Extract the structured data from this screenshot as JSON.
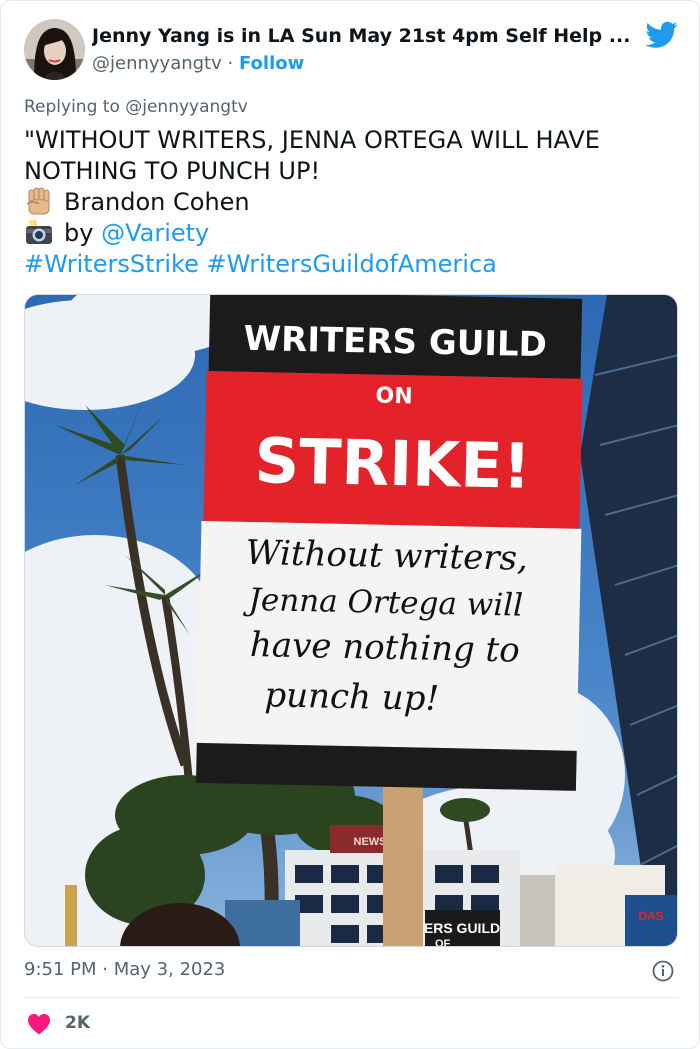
{
  "author": {
    "display_name": "Jenny Yang is in LA Sun May 21st 4pm Self Help ...",
    "handle": "@jennyyangtv",
    "separator": "·",
    "follow_label": "Follow"
  },
  "reply_context": {
    "prefix": "Replying to",
    "mention": "@jennyyangtv"
  },
  "tweet": {
    "line1": "\"WITHOUT WRITERS, JENNA ORTEGA WILL HAVE",
    "line2": "NOTHING TO PUNCH UP!",
    "credit_name": "Brandon Cohen",
    "credit_by": "by",
    "credit_mention": "@Variety",
    "hashtag1": "#WritersStrike",
    "hashtag2": "#WritersGuildofAmerica"
  },
  "photo": {
    "sign_top": "WRITERS GUILD",
    "sign_on": "ON",
    "sign_strike": "STRIKE!",
    "handwritten_1": "Without writers,",
    "handwritten_2": "Jenna Ortega will",
    "handwritten_3": "have nothing to",
    "handwritten_4": "punch up!",
    "background_sign": "ERS GUILD",
    "background_sign_2": "OF",
    "building_banner": "NEWS",
    "storefront_sign": "DAS"
  },
  "meta": {
    "time": "9:51 PM",
    "separator": "·",
    "date": "May 3, 2023"
  },
  "engagement": {
    "likes": "2K"
  },
  "colors": {
    "link": "#1d9bf0",
    "heart": "#f91880",
    "muted": "#536471",
    "strike_red": "#e4222a"
  },
  "icons": {
    "brand": "twitter-bird-icon",
    "fist": "raised-fist-emoji-icon",
    "camera": "camera-flash-emoji-icon",
    "info": "info-icon",
    "like": "heart-icon"
  }
}
